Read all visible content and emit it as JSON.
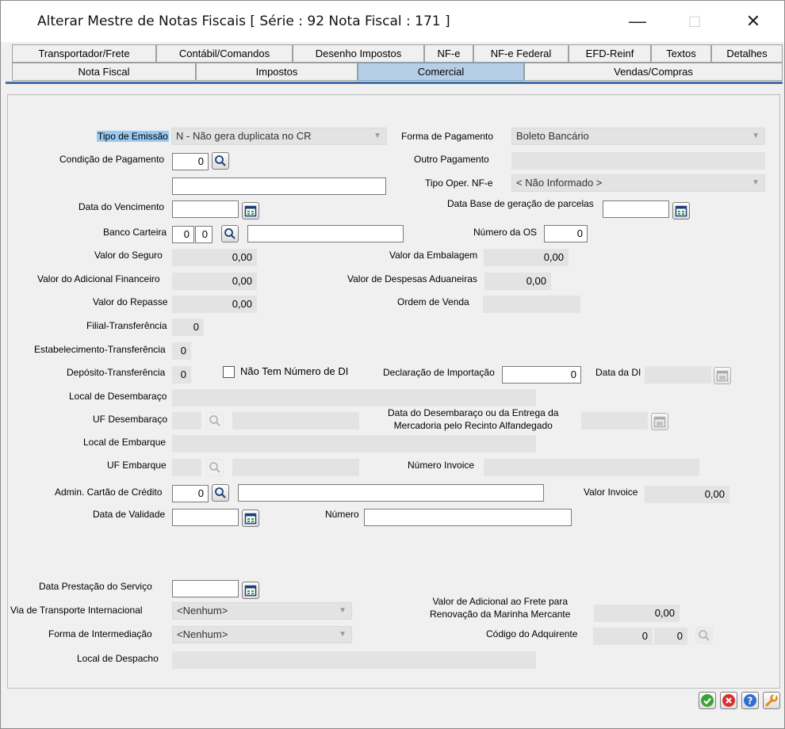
{
  "window": {
    "title": "Alterar Mestre de Notas Fiscais [ Série : 92  Nota Fiscal : 171 ]",
    "minimize": "—",
    "maximize": "□",
    "close": "✕"
  },
  "tabs_row1": [
    "Transportador/Frete",
    "Contábil/Comandos",
    "Desenho Impostos",
    "NF-e",
    "NF-e Federal",
    "EFD-Reinf",
    "Textos",
    "Detalhes"
  ],
  "tabs_row2": [
    "Nota Fiscal",
    "Impostos",
    "Comercial",
    "Vendas/Compras"
  ],
  "active_tab": "Comercial",
  "form": {
    "tipo_emissao": {
      "label": "Tipo de Emissão",
      "value": "N - Não gera duplicata no CR"
    },
    "forma_pagamento": {
      "label": "Forma de Pagamento",
      "value": "Boleto Bancário"
    },
    "condicao_pagamento": {
      "label": "Condição de Pagamento",
      "value": "0",
      "desc": ""
    },
    "outro_pagamento": {
      "label": "Outro Pagamento",
      "value": ""
    },
    "tipo_oper_nfe": {
      "label": "Tipo Oper. NF-e",
      "value": "< Não Informado >"
    },
    "data_vencimento": {
      "label": "Data do Vencimento",
      "value": ""
    },
    "data_base_parcelas": {
      "label": "Data Base de geração de parcelas",
      "value": ""
    },
    "banco_carteira": {
      "label": "Banco Carteira",
      "banco": "0",
      "carteira": "0",
      "desc": ""
    },
    "numero_os": {
      "label": "Número da OS",
      "value": "0"
    },
    "valor_seguro": {
      "label": "Valor do Seguro",
      "value": "0,00"
    },
    "valor_embalagem": {
      "label": "Valor da Embalagem",
      "value": "0,00"
    },
    "valor_adicional_financeiro": {
      "label": "Valor do Adicional Financeiro",
      "value": "0,00"
    },
    "valor_despesas_aduaneiras": {
      "label": "Valor de Despesas Aduaneiras",
      "value": "0,00"
    },
    "valor_repasse": {
      "label": "Valor do Repasse",
      "value": "0,00"
    },
    "ordem_venda": {
      "label": "Ordem de Venda",
      "value": ""
    },
    "filial_transferencia": {
      "label": "Filial-Transferência",
      "value": "0"
    },
    "estabelecimento_transferencia": {
      "label": "Estabelecimento-Transferência",
      "value": "0"
    },
    "deposito_transferencia": {
      "label": "Depósito-Transferência",
      "value": "0"
    },
    "nao_tem_numero_di": {
      "label": "Não Tem Número de DI",
      "checked": false
    },
    "declaracao_importacao": {
      "label": "Declaração de Importação",
      "value": "0"
    },
    "data_di": {
      "label": "Data da DI",
      "value": ""
    },
    "local_desembaraco": {
      "label": "Local de Desembaraço",
      "value": ""
    },
    "uf_desembaraco": {
      "label": "UF Desembaraço",
      "value": "",
      "desc": ""
    },
    "data_desembaraco": {
      "label_line1": "Data do Desembaraço ou da Entrega da",
      "label_line2": "Mercadoria pelo Recinto Alfandegado",
      "value": ""
    },
    "local_embarque": {
      "label": "Local de Embarque",
      "value": ""
    },
    "uf_embarque": {
      "label": "UF Embarque",
      "value": "",
      "desc": ""
    },
    "numero_invoice": {
      "label": "Número Invoice",
      "value": ""
    },
    "admin_cartao": {
      "label": "Admin. Cartão de Crédito",
      "value": "0",
      "desc": ""
    },
    "valor_invoice": {
      "label": "Valor Invoice",
      "value": "0,00"
    },
    "data_validade": {
      "label": "Data de Validade",
      "value": ""
    },
    "numero": {
      "label": "Número",
      "value": ""
    },
    "data_prestacao_servico": {
      "label": "Data Prestação do Serviço",
      "value": ""
    },
    "via_transporte": {
      "label": "Via de Transporte Internacional",
      "value": "<Nenhum>"
    },
    "valor_adicional_frete": {
      "label_line1": "Valor de Adicional ao Frete para",
      "label_line2": "Renovação da Marinha Mercante",
      "value": "0,00"
    },
    "forma_intermediacao": {
      "label": "Forma de Intermediação",
      "value": "<Nenhum>"
    },
    "codigo_adquirente": {
      "label": "Código do Adquirente",
      "value1": "0",
      "value2": "0"
    },
    "local_despacho": {
      "label": "Local de Despacho",
      "value": ""
    }
  },
  "footer_buttons": {
    "ok": "ok-icon",
    "cancel": "cancel-icon",
    "help": "help-icon",
    "tools": "wrench-icon"
  },
  "colors": {
    "active_tab": "#b6cfe6",
    "tab_underline": "#3f6fa5",
    "label_highlight": "#99c9f0",
    "ok_green": "#3aa335",
    "cancel_red": "#d9302c",
    "help_blue": "#2f6fd1",
    "tools_orange": "#e08a1e"
  }
}
